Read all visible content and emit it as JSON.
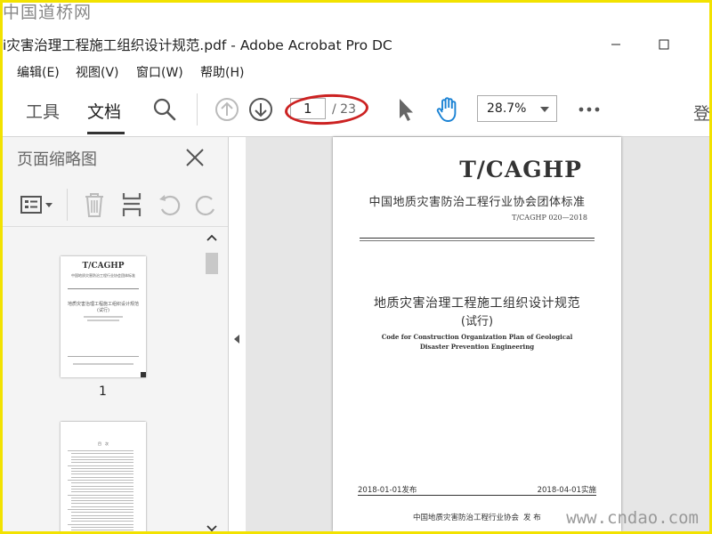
{
  "watermark": {
    "top": "中国道桥网",
    "bottom": "www.cndao.com"
  },
  "window": {
    "title": "i灾害治理工程施工组织设计规范.pdf - Adobe Acrobat Pro DC"
  },
  "menu": {
    "items": [
      "编辑(E)",
      "视图(V)",
      "窗口(W)",
      "帮助(H)"
    ]
  },
  "toolbar": {
    "tabs": [
      "工具",
      "文档"
    ],
    "page_current": "1",
    "page_total": "/ 23",
    "zoom": "28.7%",
    "right_label": "登"
  },
  "sidebar": {
    "title": "页面缩略图",
    "thumb_label": "1",
    "thumb1": {
      "code": "T/CAGHP",
      "assoc": "中国地质灾害防治工程行业协会团体标准",
      "title": "地质灾害治理工程施工组织设计规范",
      "sub": "(试行)"
    },
    "thumb2": {
      "heading": "目　次"
    }
  },
  "document": {
    "code": "T/CAGHP",
    "association": "中国地质灾害防治工程行业协会团体标准",
    "number": "T/CAGHP 020—2018",
    "title": "地质灾害治理工程施工组织设计规范",
    "subtitle": "(试行)",
    "english_1": "Code for Construction Organization Plan of Geological",
    "english_2": "Disaster Prevention Engineering",
    "issue_date": "2018-01-01发布",
    "impl_date": "2018-04-01实施",
    "publisher": "中国地质灾害防治工程行业协会",
    "publish_word": "发 布"
  },
  "colors": {
    "accent": "#1a82d4",
    "highlight_oval": "#cc2222",
    "border": "#f2e200"
  },
  "icons": [
    "search-icon",
    "arrow-up-icon",
    "arrow-down-icon",
    "select-arrow-icon",
    "hand-icon",
    "more-icon",
    "close-icon",
    "options-icon",
    "delete-icon",
    "insert-icon",
    "undo-icon",
    "redo-icon",
    "scroll-up-icon",
    "scroll-down-icon",
    "collapse-left-icon"
  ]
}
